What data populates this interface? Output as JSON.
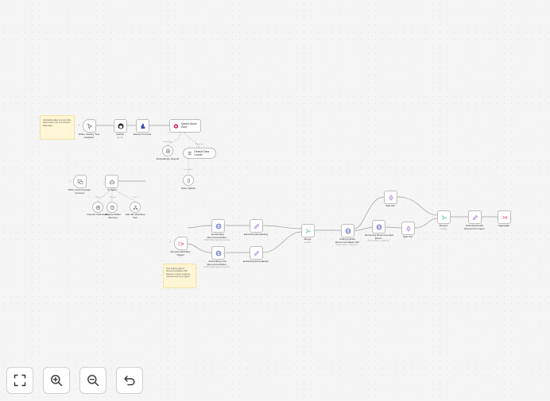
{
  "canvas": {
    "sticky_notes": [
      {
        "id": "note-top",
        "text": "Uploading data sources that have some sort of a Cancer Risk data"
      },
      {
        "id": "note-bottom",
        "text": "Test calling Qdrant Recommendation API based on user's request, transformed by AI agent"
      }
    ],
    "nodes": [
      {
        "id": "when-clicking-test-workflow",
        "label": "When clicking 'Test workflow'",
        "icon": "pointer-icon",
        "icon_color": "#555555"
      },
      {
        "id": "github",
        "label": "GitHub",
        "sublabel": "get: file",
        "icon": "github-icon",
        "icon_color": "#222222"
      },
      {
        "id": "extract-from-file",
        "label": "Extract from File",
        "icon": "file-extract-icon",
        "icon_color": "#3f51b5"
      },
      {
        "id": "qdrant-vector-store",
        "label": "Qdrant Vector Store",
        "icon": "qdrant-icon",
        "icon_color": "#dc244c"
      },
      {
        "id": "embeddings-openai",
        "label": "Embeddings OpenAI",
        "icon": "openai-icon",
        "icon_color": "#444444"
      },
      {
        "id": "default-data-loader",
        "label": "Default Data Loader",
        "icon": "data-loader-icon",
        "icon_color": "#666666"
      },
      {
        "id": "token-splitter",
        "label": "Token Splitter",
        "icon": "splitter-icon",
        "icon_color": "#666666"
      },
      {
        "id": "when-chat-message-received",
        "label": "When chat message received",
        "icon": "chat-icon",
        "icon_color": "#555555"
      },
      {
        "id": "ai-agent",
        "label": "AI Agent",
        "icon": "robot-icon",
        "icon_color": "#555555"
      },
      {
        "id": "openai-chat-model",
        "label": "OpenAI Chat Model",
        "icon": "openai-icon",
        "icon_color": "#444444"
      },
      {
        "id": "window-buffer-memory",
        "label": "Window Buffer Memory",
        "icon": "memory-icon",
        "icon_color": "#555555"
      },
      {
        "id": "call-n8n-workflow-tool",
        "label": "Call n8n Workflow Tool",
        "icon": "workflow-icon",
        "icon_color": "#555555"
      },
      {
        "id": "execute-workflow-trigger",
        "label": "Execute Workflow Trigger",
        "icon": "execute-icon",
        "icon_color": "#ee4f7d"
      },
      {
        "id": "embedding-recommendation",
        "label": "Embedding Recommendation...",
        "sublabel": "POST: https://api.openai.com/...",
        "icon": "globe-icon",
        "icon_color": "#3f51b5"
      },
      {
        "id": "embedding-anti-recommendation",
        "label": "Embedding Anti-Recommendation...",
        "sublabel": "POST: https://api.openai.com/...",
        "icon": "globe-icon",
        "icon_color": "#3f51b5"
      },
      {
        "id": "extracting-embedding",
        "label": "Extracting Embedding",
        "icon": "pen-icon",
        "icon_color": "#8e4fd4"
      },
      {
        "id": "extracting-embedding1",
        "label": "Extracting Embedding1",
        "icon": "pen-icon",
        "icon_color": "#8e4fd4"
      },
      {
        "id": "merge",
        "label": "Merge",
        "sublabel": "combine",
        "icon": "merge-icon",
        "icon_color": "#26b5a6"
      },
      {
        "id": "calling-qdrant-recommendation-api",
        "label": "Calling Qdrant Recommendation API",
        "sublabel": "POST: https://...qdrant.io/...",
        "icon": "globe-icon",
        "icon_color": "#3f51b5"
      },
      {
        "id": "retrieving-recommended-results",
        "label": "Retrieving Recommended Resul...",
        "sublabel": "POST: https://...qdrant.io/...",
        "icon": "globe-icon",
        "icon_color": "#3f51b5"
      },
      {
        "id": "split-out",
        "label": "Split Out",
        "icon": "split-out-icon",
        "icon_color": "#8e4fd4"
      },
      {
        "id": "split-out1",
        "label": "Split Out",
        "icon": "split-out-icon",
        "icon_color": "#8e4fd4"
      },
      {
        "id": "merge1",
        "label": "Merge1",
        "sublabel": "combine",
        "icon": "merge-icon",
        "icon_color": "#26b5a6"
      },
      {
        "id": "selecting-fields-relevant-for-agent",
        "label": "Selecting Fields Relevant for Agent",
        "icon": "pen-icon",
        "icon_color": "#8e4fd4"
      },
      {
        "id": "aggregate",
        "label": "Aggregate",
        "icon": "aggregate-icon",
        "icon_color": "#ee4f7d"
      }
    ],
    "connector_labels": {
      "embedding": "Embedding",
      "document": "Document",
      "text_splitter": "Text Splitter",
      "model": "Model",
      "memory": "Memory",
      "tool": "Tool"
    }
  },
  "toolbar": [
    {
      "id": "zoom-to-fit",
      "icon": "fit-view-icon"
    },
    {
      "id": "zoom-in",
      "icon": "zoom-in-icon"
    },
    {
      "id": "zoom-out",
      "icon": "zoom-out-icon"
    },
    {
      "id": "undo",
      "icon": "undo-icon"
    }
  ],
  "colors": {
    "canvas_background": "#f5f5f5",
    "node_border": "#bdbdbd",
    "connection": "#9e9e9e",
    "sticky_background": "#fff6d5",
    "accent_pink": "#ee4f7d"
  }
}
